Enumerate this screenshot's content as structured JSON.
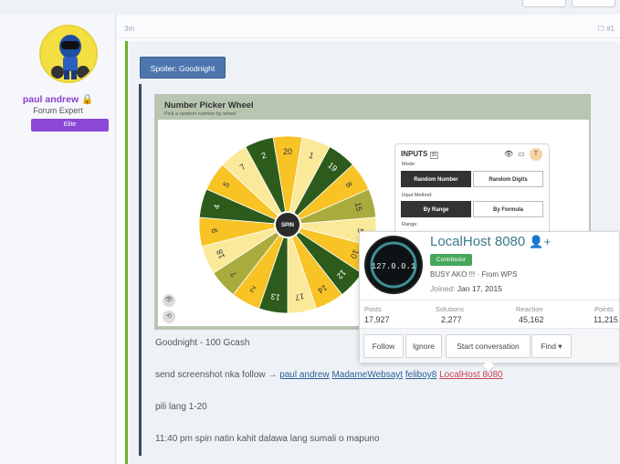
{
  "post": {
    "time": "3m",
    "icons": "☐  #1"
  },
  "user": {
    "name": "paul andrew",
    "title": "Forum Expert",
    "badge": "Elite"
  },
  "spoiler": {
    "label": "Spoiler: Goodnight"
  },
  "wheel": {
    "title": "Number Picker Wheel",
    "subtitle": "Pick a random number by wheel",
    "center": "SPIN",
    "segments": [
      "20",
      "1",
      "19",
      "8",
      "15",
      "5",
      "10",
      "12",
      "14",
      "17",
      "13",
      "2",
      "7",
      "18",
      "9",
      "4",
      "5",
      "7",
      "2"
    ],
    "colors": [
      "#f7c325",
      "#fbe99a",
      "#2d5b1c",
      "#f7c325",
      "#a9ac3c",
      "#fbe99a",
      "#f7c325",
      "#2d5b1c"
    ]
  },
  "inputs": {
    "title": "INPUTS",
    "count": "20",
    "mode_label": "Mode:",
    "btn_random_number": "Random Number",
    "btn_random_digits": "Random Digits",
    "input_method_label": "Input Method:",
    "btn_by_range": "By Range",
    "btn_by_formula": "By Formula",
    "range_label": "Range:"
  },
  "content": {
    "line1": "Goodnight - 100 Gcash",
    "line2_prefix": "send screenshot nka follow → ",
    "mentions": [
      "paul andrew",
      "MadameWebsayt",
      "feliboy8"
    ],
    "mention_red": "LocalHost 8080",
    "line3": "pili lang 1-20",
    "line4": "11:40 pm spin natin kahit dalawa lang sumali o mapuno"
  },
  "popup": {
    "avatar_text": "127.0.0.1",
    "name": "LocalHost 8080",
    "badge": "Contributor",
    "status": "BUSY AKO !!! · From WPS",
    "joined_label": "Joined: ",
    "joined_value": "Jan 17, 2015",
    "stats": [
      {
        "label": "Posts",
        "value": "17,927"
      },
      {
        "label": "Solutions",
        "value": "2,277"
      },
      {
        "label": "Reaction",
        "value": "45,162"
      },
      {
        "label": "Points",
        "value": "11,215"
      }
    ],
    "buttons": {
      "follow": "Follow",
      "ignore": "Ignore",
      "start_conversation": "Start conversation",
      "find": "Find ▾"
    }
  }
}
